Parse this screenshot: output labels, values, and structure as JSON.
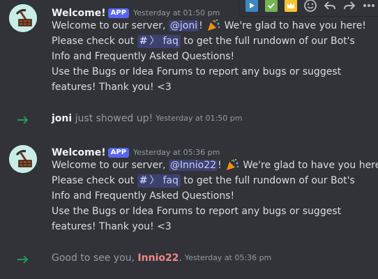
{
  "messages": [
    {
      "author": "Welcome!",
      "badge": "APP",
      "timestamp": "Yesterday at 01:50 pm",
      "welcome_prefix": "Welcome to our server, ",
      "mention": "@joni",
      "welcome_suffix": "! ",
      "welcome_end": " We're glad to have you here!",
      "check_prefix": "Please check out ",
      "channel": "faq",
      "check_suffix": " to get the full rundown of our Bot's",
      "check_line2": "Info and Frequently Asked Questions!",
      "bugs_line1": "Use the Bugs or Idea Forums to report any bugs or suggest",
      "bugs_line2": "features! Thank you! <3"
    },
    {
      "author": "Welcome!",
      "badge": "APP",
      "timestamp": "Yesterday at 05:36 pm",
      "welcome_prefix": "Welcome to our server, ",
      "mention": "@Innio22",
      "welcome_suffix": "! ",
      "welcome_end": " We're glad to have you here!",
      "check_prefix": "Please check out ",
      "channel": "faq",
      "check_suffix": " to get the full rundown of our Bot's",
      "check_line2": "Info and Frequently Asked Questions!",
      "bugs_line1": "Use the Bugs or Idea Forums to report any bugs or suggest",
      "bugs_line2": "features! Thank you! <3"
    }
  ],
  "system_messages": [
    {
      "user": "joni",
      "text": " just showed up!",
      "timestamp": "Yesterday at 01:50 pm"
    },
    {
      "prefix": "Good to see you, ",
      "user": "Innio22",
      "suffix": ".",
      "timestamp": "Yesterday at 05:36 pm"
    }
  ],
  "icons": {
    "avatar": "pickaxe-mine-icon",
    "emoji": "party-popper-icon",
    "join_arrow": "arrow-right-icon",
    "toolbar": [
      "play-reaction-icon",
      "check-reaction-icon",
      "crown-reaction-icon",
      "add-reaction-icon",
      "reply-icon",
      "forward-icon",
      "more-icon"
    ]
  },
  "colors": {
    "background": "#313338",
    "mention_bg": "#5865f2",
    "timestamp": "#949ba4",
    "join_arrow": "#23a55a",
    "red_user": "#f38688"
  }
}
